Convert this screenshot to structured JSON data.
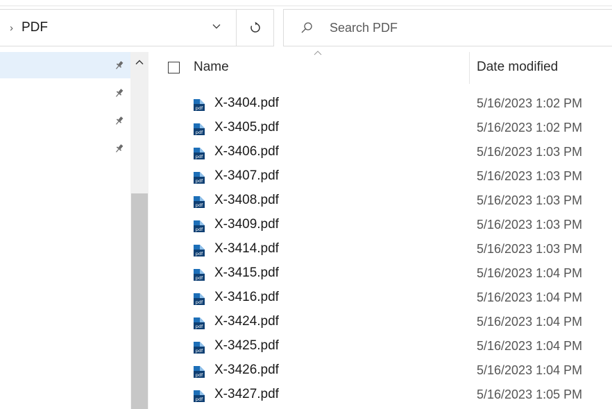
{
  "address": {
    "path": "PDF"
  },
  "search": {
    "placeholder": "Search PDF"
  },
  "columns": {
    "name": "Name",
    "date_modified": "Date modified"
  },
  "files": [
    {
      "name": "X-3404.pdf",
      "date": "5/16/2023 1:02 PM"
    },
    {
      "name": "X-3405.pdf",
      "date": "5/16/2023 1:02 PM"
    },
    {
      "name": "X-3406.pdf",
      "date": "5/16/2023 1:03 PM"
    },
    {
      "name": "X-3407.pdf",
      "date": "5/16/2023 1:03 PM"
    },
    {
      "name": "X-3408.pdf",
      "date": "5/16/2023 1:03 PM"
    },
    {
      "name": "X-3409.pdf",
      "date": "5/16/2023 1:03 PM"
    },
    {
      "name": "X-3414.pdf",
      "date": "5/16/2023 1:03 PM"
    },
    {
      "name": "X-3415.pdf",
      "date": "5/16/2023 1:04 PM"
    },
    {
      "name": "X-3416.pdf",
      "date": "5/16/2023 1:04 PM"
    },
    {
      "name": "X-3424.pdf",
      "date": "5/16/2023 1:04 PM"
    },
    {
      "name": "X-3425.pdf",
      "date": "5/16/2023 1:04 PM"
    },
    {
      "name": "X-3426.pdf",
      "date": "5/16/2023 1:04 PM"
    },
    {
      "name": "X-3427.pdf",
      "date": "5/16/2023 1:05 PM"
    }
  ],
  "icons": {
    "file": "pdf-file-icon",
    "pin": "pin-icon",
    "refresh": "refresh-icon",
    "search": "search-icon",
    "dropdown": "chevron-down-icon"
  },
  "colors": {
    "selection": "#e5f0fb",
    "pdf_icon_blue": "#1d6fb8",
    "pdf_icon_dark": "#0e3f73",
    "scroll_thumb": "#c7c7c7"
  }
}
